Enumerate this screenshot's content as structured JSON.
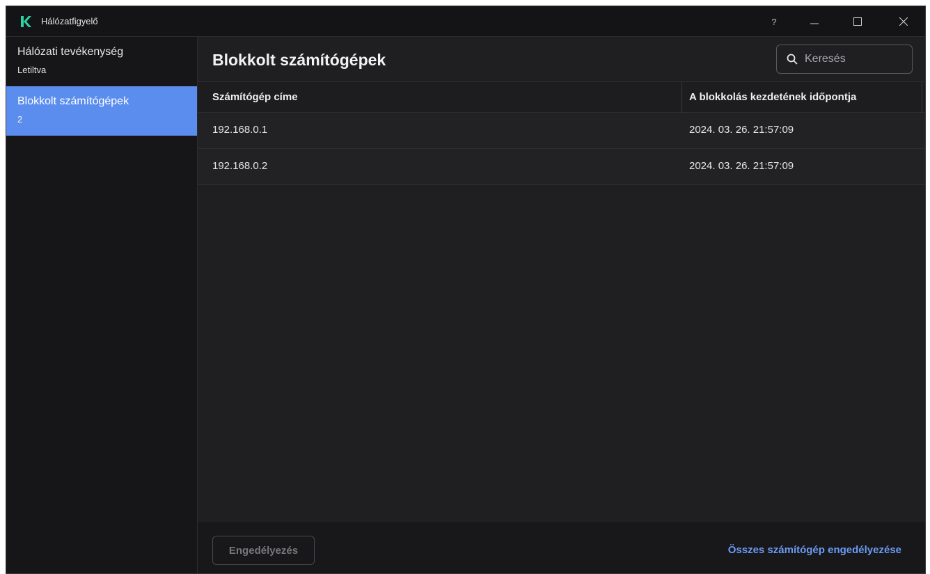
{
  "window": {
    "title": "Hálózatfigyelő",
    "help_label": "?"
  },
  "colors": {
    "accent": "#5b8def",
    "logo": "#2bd4a0",
    "link": "#6c9bf5",
    "background": "#1c1c1e"
  },
  "sidebar": {
    "items": [
      {
        "label": "Hálózati tevékenység",
        "sub": "Letiltva",
        "selected": false
      },
      {
        "label": "Blokkolt számítógépek",
        "sub": "2",
        "selected": true
      }
    ]
  },
  "main": {
    "title": "Blokkolt számítógépek",
    "search": {
      "placeholder": "Keresés",
      "icon": "search-icon"
    },
    "table": {
      "columns": [
        "Számítógép címe",
        "A blokkolás kezdetének időpontja"
      ],
      "rows": [
        [
          "192.168.0.1",
          "2024. 03. 26. 21:57:09"
        ],
        [
          "192.168.0.2",
          "2024. 03. 26. 21:57:09"
        ]
      ]
    },
    "footer": {
      "allow_label": "Engedélyezés",
      "allow_all_label": "Összes számítógép engedélyezése"
    }
  }
}
